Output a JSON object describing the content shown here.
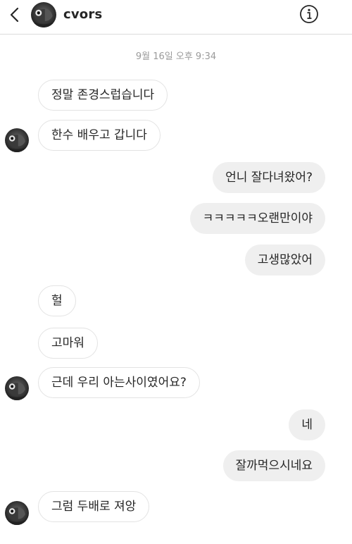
{
  "header": {
    "username": "cvors",
    "back_icon": "chevron-left-icon",
    "info_icon": "info-icon"
  },
  "timestamp": "9월 16일 오후 9:34",
  "messages": [
    {
      "direction": "incoming",
      "text": "정말 존경스럽습니다"
    },
    {
      "direction": "incoming",
      "text": "한수 배우고 갑니다"
    },
    {
      "direction": "outgoing",
      "text": "언니 잘다녀왔어?"
    },
    {
      "direction": "outgoing",
      "text": "ㅋㅋㅋㅋㅋ오랜만이야"
    },
    {
      "direction": "outgoing",
      "text": "고생많았어"
    },
    {
      "direction": "incoming",
      "text": "헐"
    },
    {
      "direction": "incoming",
      "text": "고마워"
    },
    {
      "direction": "incoming",
      "text": "근데 우리 아는사이였어요?"
    },
    {
      "direction": "outgoing",
      "text": "네"
    },
    {
      "direction": "outgoing",
      "text": "잘까먹으시네요"
    },
    {
      "direction": "incoming",
      "text": "그럼 두배로 져앙"
    }
  ],
  "colors": {
    "incoming_bubble_bg": "#ffffff",
    "incoming_bubble_border": "#e3e3e3",
    "outgoing_bubble_bg": "#efefef",
    "text": "#262626",
    "timestamp": "#9a9a9a"
  }
}
